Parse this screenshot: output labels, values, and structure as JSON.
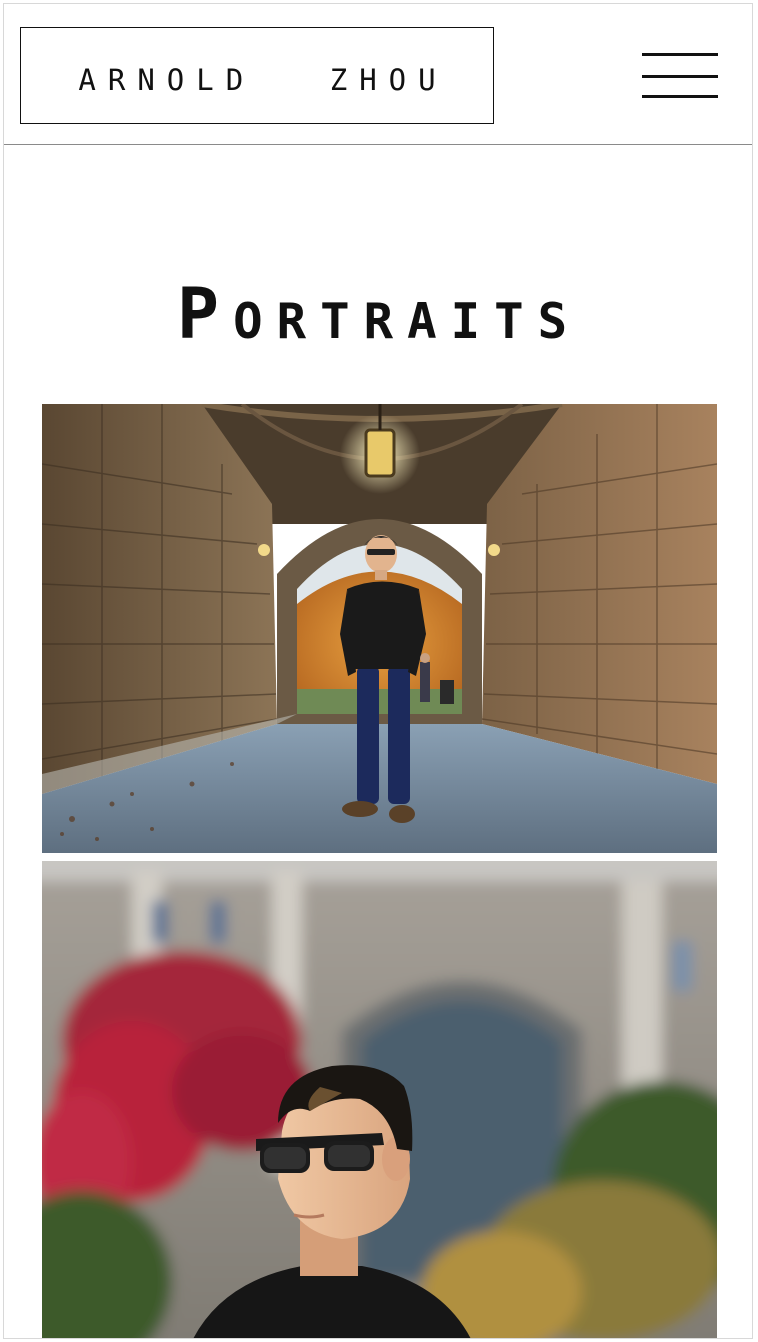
{
  "header": {
    "logo_first": "Arnold",
    "logo_last": "Zhou",
    "menu_icon": "hamburger-menu-icon"
  },
  "main": {
    "title": "Portraits",
    "photos": [
      {
        "name": "archway-portrait"
      },
      {
        "name": "ivy-building-portrait"
      }
    ]
  },
  "colors": {
    "text": "#111111",
    "border": "#8a8a8a",
    "background": "#ffffff"
  }
}
